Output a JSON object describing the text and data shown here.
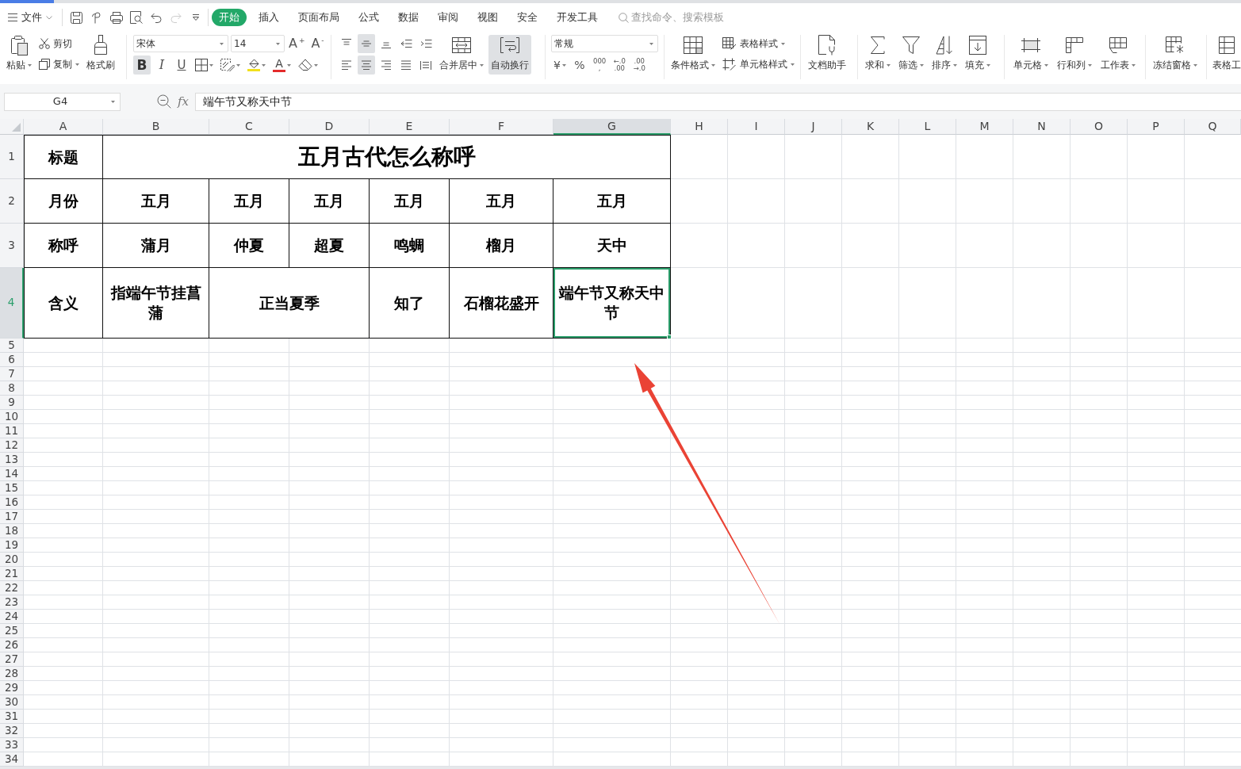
{
  "menu_bar": {
    "file_menu": {
      "label": "文件"
    },
    "quick_access": [
      {
        "disabled": false
      },
      {
        "disabled": false
      },
      {
        "disabled": false
      },
      {
        "disabled": false
      },
      {
        "disabled": false
      },
      {
        "disabled": true
      },
      {
        "disabled": false
      }
    ]
  },
  "tabs": [
    {
      "label": "开始",
      "selected": true
    },
    {
      "label": "插入",
      "selected": false
    },
    {
      "label": "页面布局",
      "selected": false
    },
    {
      "label": "公式",
      "selected": false
    },
    {
      "label": "数据",
      "selected": false
    },
    {
      "label": "审阅",
      "selected": false
    },
    {
      "label": "视图",
      "selected": false
    },
    {
      "label": "安全",
      "selected": false
    },
    {
      "label": "开发工具",
      "selected": false
    }
  ],
  "search": {
    "placeholder": "查找命令、搜索模板"
  },
  "ribbon": {
    "clipboard": [
      {
        "kind": "paste",
        "label": "粘贴",
        "has_menu": true
      },
      {
        "kind": "cut",
        "label": "剪切",
        "has_menu": false
      },
      {
        "kind": "copy",
        "label": "复制",
        "has_menu": true
      },
      {
        "kind": "painter",
        "label": "格式刷",
        "has_menu": false
      }
    ],
    "font": {
      "name": "宋体",
      "size": "14",
      "size_steps": [
        "A$^{+}$",
        "A$^{-}$"
      ],
      "styles": [
        {
          "label": "B",
          "selected": true
        },
        {
          "label": "I",
          "selected": false
        },
        {
          "label": "U",
          "selected": false
        }
      ],
      "tools": [
        {
          "kind": "borders",
          "has_menu": true
        },
        {
          "kind": "pattern",
          "has_menu": true
        },
        {
          "kind": "fill_color",
          "has_menu": true,
          "color": "#f2e01c"
        },
        {
          "kind": "font_color",
          "label": "A",
          "has_menu": true,
          "color": "#e42b2b"
        },
        {
          "kind": "clear",
          "has_menu": true
        }
      ]
    },
    "alignment": {
      "vertical": [
        {
          "kind": "top",
          "selected": false
        },
        {
          "kind": "middle",
          "selected": true
        },
        {
          "kind": "bottom",
          "selected": false
        }
      ],
      "horizontal": [
        {
          "kind": "left",
          "selected": false
        },
        {
          "kind": "center",
          "selected": true
        },
        {
          "kind": "right",
          "selected": false
        },
        {
          "kind": "justify",
          "selected": false
        },
        {
          "kind": "distributed",
          "selected": false
        }
      ],
      "actions": [
        {
          "kind": "merge",
          "label": "合并居中",
          "has_menu": true,
          "selected": false
        },
        {
          "kind": "wrap",
          "label": "自动换行",
          "has_menu": false,
          "selected": true
        }
      ]
    },
    "number": {
      "format": "常规",
      "tools": [
        {
          "label": "¥",
          "has_menu": true
        },
        {
          "label": "%",
          "has_menu": false
        },
        {
          "lines": [
            "000",
            ","
          ]
        },
        {
          "lines": [
            "←.0",
            ".00"
          ]
        },
        {
          "lines": [
            ".00",
            "→.0"
          ]
        }
      ]
    },
    "styles": [
      {
        "kind": "conditional",
        "label": "条件格式",
        "has_menu": true
      },
      {
        "kind": "table_style",
        "label": "表格样式",
        "has_menu": true
      },
      {
        "kind": "cell_style",
        "label": "单元格样式",
        "has_menu": true
      }
    ],
    "assistant": [
      {
        "kind": "assistant",
        "label": "文档助手",
        "has_menu": false
      }
    ],
    "editing": [
      {
        "kind": "sum",
        "label": "求和",
        "has_menu": true
      },
      {
        "kind": "filter",
        "label": "筛选",
        "has_menu": true
      },
      {
        "kind": "sort",
        "label": "排序",
        "has_menu": true
      },
      {
        "kind": "fill",
        "label": "填充",
        "has_menu": true
      }
    ],
    "cells": [
      {
        "kind": "cell",
        "label": "单元格",
        "has_menu": true
      },
      {
        "kind": "rows_cols",
        "label": "行和列",
        "has_menu": true
      },
      {
        "kind": "worksheet",
        "label": "工作表",
        "has_menu": true
      }
    ],
    "freeze": [
      {
        "kind": "freeze",
        "label": "冻结窗格",
        "has_menu": true
      }
    ],
    "table_tools": [
      {
        "kind": "table_tools",
        "label": "表格工",
        "has_menu": false
      }
    ]
  },
  "formula_bar": {
    "name_box": "G4",
    "function_label": "fx",
    "formula": "端午节又称天中节"
  },
  "sheet": {
    "columns": [
      {
        "label": "A",
        "selected": false
      },
      {
        "label": "B",
        "selected": false
      },
      {
        "label": "C",
        "selected": false
      },
      {
        "label": "D",
        "selected": false
      },
      {
        "label": "E",
        "selected": false
      },
      {
        "label": "F",
        "selected": false
      },
      {
        "label": "G",
        "selected": true
      },
      {
        "label": "H",
        "selected": false
      },
      {
        "label": "I",
        "selected": false
      },
      {
        "label": "J",
        "selected": false
      },
      {
        "label": "K",
        "selected": false
      },
      {
        "label": "L",
        "selected": false
      },
      {
        "label": "M",
        "selected": false
      },
      {
        "label": "N",
        "selected": false
      },
      {
        "label": "O",
        "selected": false
      },
      {
        "label": "P",
        "selected": false
      },
      {
        "label": "Q",
        "selected": false
      }
    ],
    "rows": [
      {
        "label": "1",
        "selected": false
      },
      {
        "label": "2",
        "selected": false
      },
      {
        "label": "3",
        "selected": false
      },
      {
        "label": "4",
        "selected": true
      },
      {
        "label": "5",
        "selected": false
      },
      {
        "label": "6",
        "selected": false
      },
      {
        "label": "7",
        "selected": false
      },
      {
        "label": "8",
        "selected": false
      },
      {
        "label": "9",
        "selected": false
      },
      {
        "label": "10",
        "selected": false
      },
      {
        "label": "11",
        "selected": false
      },
      {
        "label": "12",
        "selected": false
      },
      {
        "label": "13",
        "selected": false
      },
      {
        "label": "14",
        "selected": false
      },
      {
        "label": "15",
        "selected": false
      },
      {
        "label": "16",
        "selected": false
      },
      {
        "label": "17",
        "selected": false
      },
      {
        "label": "18",
        "selected": false
      },
      {
        "label": "19",
        "selected": false
      },
      {
        "label": "20",
        "selected": false
      },
      {
        "label": "21",
        "selected": false
      },
      {
        "label": "22",
        "selected": false
      },
      {
        "label": "23",
        "selected": false
      },
      {
        "label": "24",
        "selected": false
      },
      {
        "label": "25",
        "selected": false
      },
      {
        "label": "26",
        "selected": false
      },
      {
        "label": "27",
        "selected": false
      },
      {
        "label": "28",
        "selected": false
      },
      {
        "label": "29",
        "selected": false
      },
      {
        "label": "30",
        "selected": false
      },
      {
        "label": "31",
        "selected": false
      },
      {
        "label": "32",
        "selected": false
      },
      {
        "label": "33",
        "selected": false
      },
      {
        "label": "34",
        "selected": false
      }
    ],
    "cells": [
      [
        {
          "text": "标题",
          "kind": "text",
          "selected": false
        },
        {
          "text": "五月古代怎么称呼",
          "kind": "title",
          "colspan": 6,
          "selected": false
        }
      ],
      [
        {
          "text": "月份",
          "kind": "text",
          "selected": false
        },
        {
          "text": "五月",
          "kind": "text",
          "selected": false
        },
        {
          "text": "五月",
          "kind": "text",
          "selected": false
        },
        {
          "text": "五月",
          "kind": "text",
          "selected": false
        },
        {
          "text": "五月",
          "kind": "text",
          "selected": false
        },
        {
          "text": "五月",
          "kind": "text",
          "selected": false
        },
        {
          "text": "五月",
          "kind": "text",
          "selected": false
        }
      ],
      [
        {
          "text": "称呼",
          "kind": "text",
          "selected": false
        },
        {
          "text": "蒲月",
          "kind": "text",
          "selected": false
        },
        {
          "text": "仲夏",
          "kind": "text",
          "selected": false
        },
        {
          "text": "超夏",
          "kind": "text",
          "selected": false
        },
        {
          "text": "鸣蜩",
          "kind": "text",
          "selected": false
        },
        {
          "text": "榴月",
          "kind": "text",
          "selected": false
        },
        {
          "text": "天中",
          "kind": "text",
          "selected": false
        }
      ],
      [
        {
          "text": "含义",
          "kind": "text",
          "selected": false
        },
        {
          "text": "指端午节挂菖蒲",
          "kind": "text",
          "selected": false
        },
        {
          "text": "正当夏季",
          "kind": "text",
          "colspan": 2,
          "selected": false
        },
        {
          "text": "知了",
          "kind": "text",
          "selected": false
        },
        {
          "text": "石榴花盛开",
          "kind": "text",
          "selected": false
        },
        {
          "text": "端午节又称天中节",
          "kind": "text",
          "selected": true
        }
      ]
    ]
  },
  "annotation": {
    "kind": "arrow"
  }
}
